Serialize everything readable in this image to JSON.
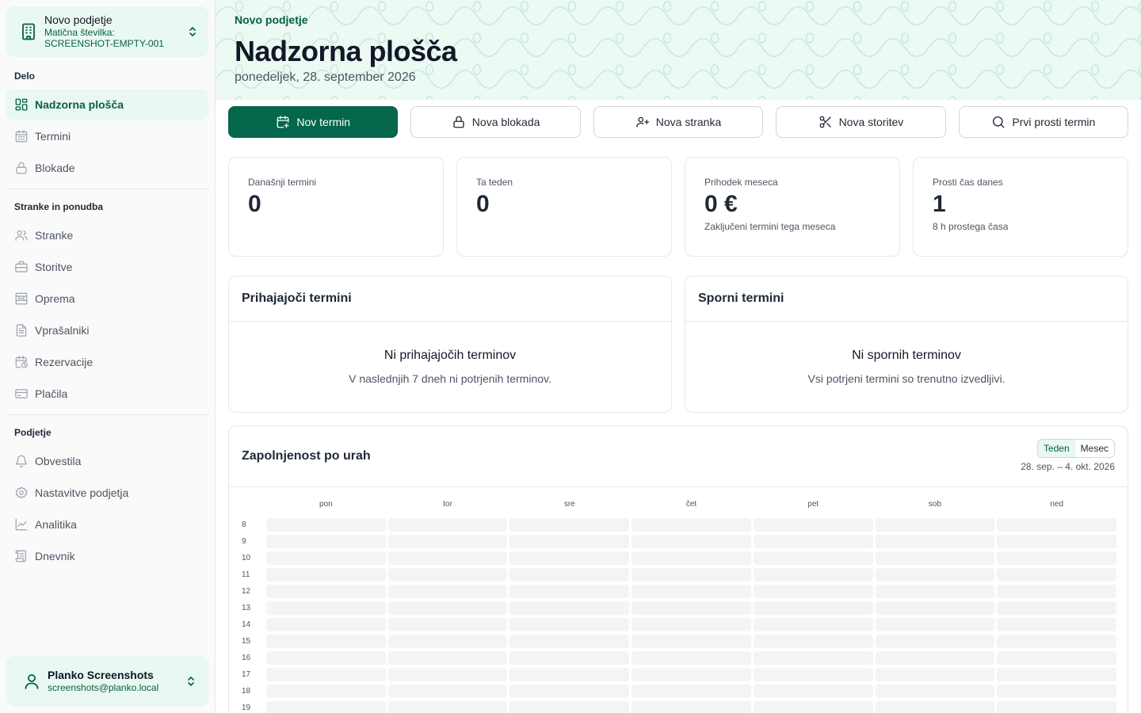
{
  "org": {
    "name": "Novo podjetje",
    "id_label": "Matična številka:",
    "id_value": "SCREENSHOT-EMPTY-001"
  },
  "nav": {
    "sections": [
      {
        "label": "Delo",
        "items": [
          {
            "label": "Nadzorna plošča",
            "icon": "dashboard-icon",
            "active": true
          },
          {
            "label": "Termini",
            "icon": "calendar-icon"
          },
          {
            "label": "Blokade",
            "icon": "lock-icon"
          }
        ]
      },
      {
        "label": "Stranke in ponudba",
        "items": [
          {
            "label": "Stranke",
            "icon": "users-icon"
          },
          {
            "label": "Storitve",
            "icon": "briefcase-icon"
          },
          {
            "label": "Oprema",
            "icon": "equipment-icon"
          },
          {
            "label": "Vprašalniki",
            "icon": "document-icon"
          },
          {
            "label": "Rezervacije",
            "icon": "calendar-clock-icon"
          },
          {
            "label": "Plačila",
            "icon": "credit-card-icon"
          }
        ]
      },
      {
        "label": "Podjetje",
        "items": [
          {
            "label": "Obvestila",
            "icon": "bell-icon"
          },
          {
            "label": "Nastavitve podjetja",
            "icon": "gear-icon"
          },
          {
            "label": "Analitika",
            "icon": "line-chart-icon"
          },
          {
            "label": "Dnevnik",
            "icon": "scroll-icon"
          }
        ]
      }
    ]
  },
  "user": {
    "name": "Planko Screenshots",
    "email": "screenshots@planko.local"
  },
  "header": {
    "breadcrumb": "Novo podjetje",
    "title": "Nadzorna plošča",
    "date": "ponedeljek, 28. september 2026"
  },
  "actions": [
    {
      "label": "Nov termin",
      "icon": "calendar-plus-icon",
      "primary": true
    },
    {
      "label": "Nova blokada",
      "icon": "lock-icon"
    },
    {
      "label": "Nova stranka",
      "icon": "user-plus-icon"
    },
    {
      "label": "Nova storitev",
      "icon": "scissors-icon"
    },
    {
      "label": "Prvi prosti termin",
      "icon": "search-icon"
    }
  ],
  "stats": [
    {
      "label": "Današnji termini",
      "value": "0",
      "sub": ""
    },
    {
      "label": "Ta teden",
      "value": "0",
      "sub": ""
    },
    {
      "label": "Prihodek meseca",
      "value": "0 €",
      "sub": "Zaključeni termini tega meseca"
    },
    {
      "label": "Prosti čas danes",
      "value": "1",
      "sub": "8 h prostega časa"
    }
  ],
  "upcoming": {
    "title": "Prihajajoči termini",
    "empty_title": "Ni prihajajočih terminov",
    "empty_desc": "V naslednjih 7 dneh ni potrjenih terminov."
  },
  "disputed": {
    "title": "Sporni termini",
    "empty_title": "Ni spornih terminov",
    "empty_desc": "Vsi potrjeni termini so trenutno izvedljivi."
  },
  "occupancy": {
    "title": "Zapolnjenost po urah",
    "toggle": {
      "week": "Teden",
      "month": "Mesec",
      "selected": "week"
    },
    "range": "28. sep. – 4. okt. 2026",
    "days": [
      "pon",
      "tor",
      "sre",
      "čet",
      "pet",
      "sob",
      "ned"
    ],
    "hours": [
      "8",
      "9",
      "10",
      "11",
      "12",
      "13",
      "14",
      "15",
      "16",
      "17",
      "18",
      "19"
    ]
  },
  "colors": {
    "accent": "#04664a",
    "accent_light": "#e9f8f1",
    "header_bg": "#edf9f3",
    "cell": "#f3f4f6"
  }
}
